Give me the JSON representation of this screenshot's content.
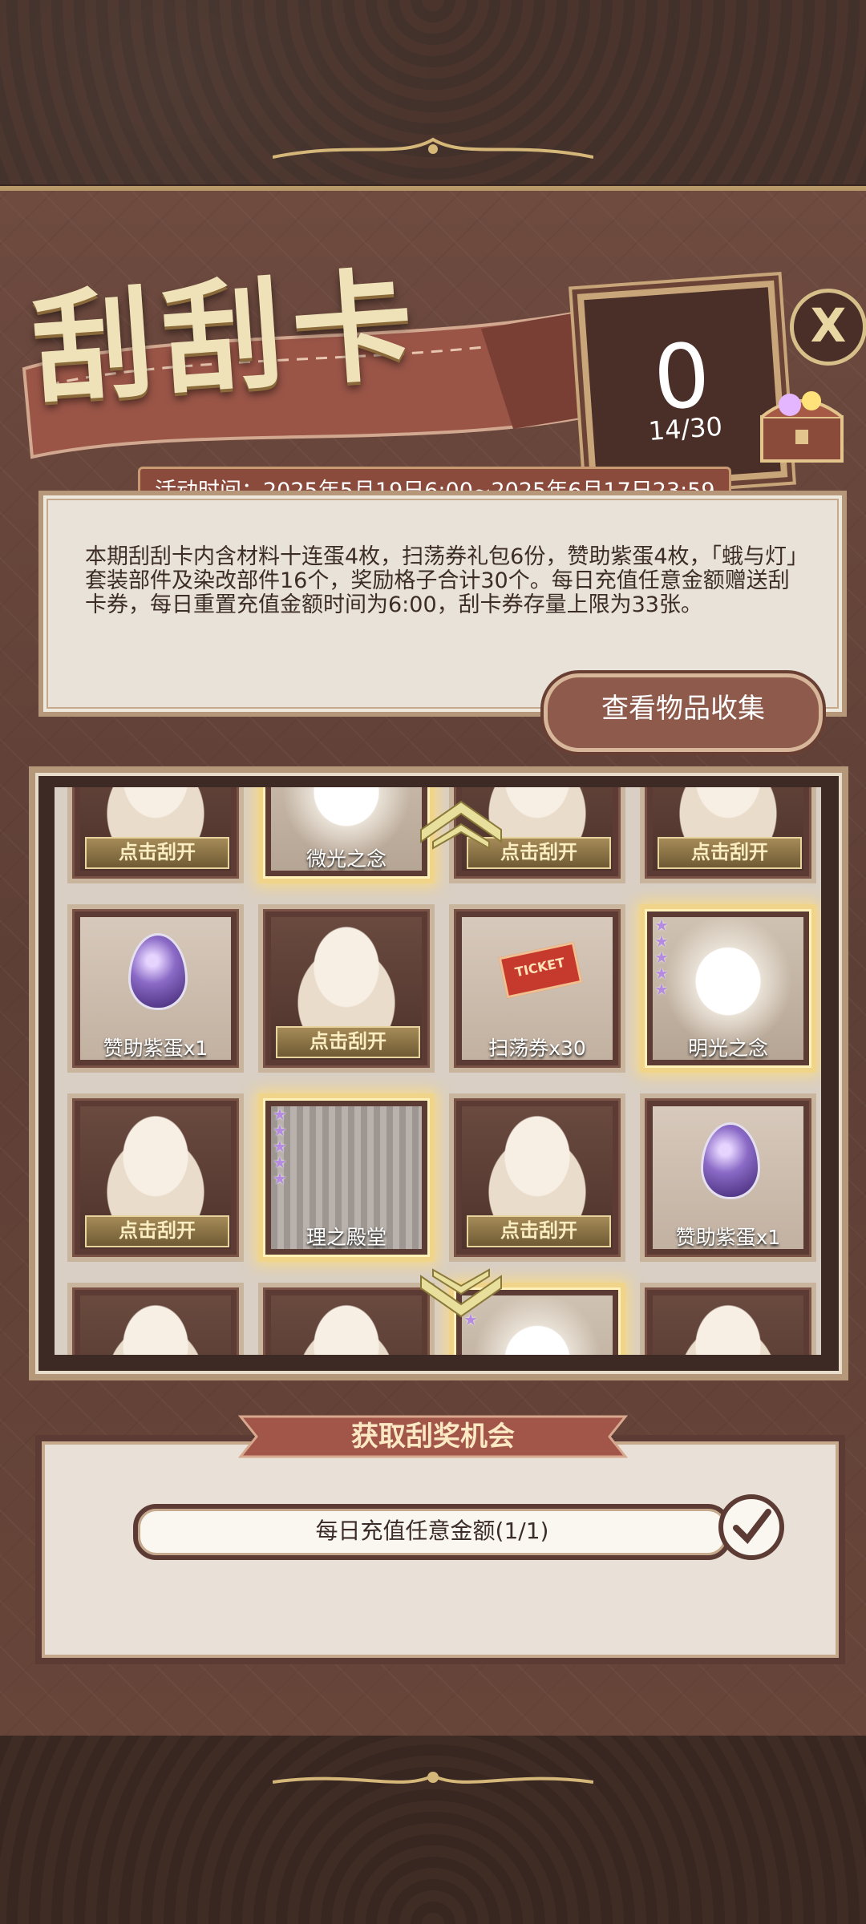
{
  "header": {
    "title": "刮刮卡",
    "counter": {
      "current": "0",
      "total": "14/30"
    },
    "close_label": "X"
  },
  "event": {
    "time": "活动时间：2025年5月19日6:00~2025年6月17日23:59",
    "description": "本期刮刮卡内含材料十连蛋4枚，扫荡券礼包6份，赞助紫蛋4枚，「蛾与灯」套装部件及染改部件16个，奖励格子合计30个。每日充值任意金额赠送刮卡券，每日重置充值金额时间为6:00，刮卡券存量上限为33张。",
    "collect_button": "查看物品收集"
  },
  "grid": {
    "scratch_label": "点击刮开",
    "rows": [
      [
        "点击刮开",
        "微光之念",
        "点击刮开",
        "点击刮开"
      ],
      [
        "赞助紫蛋x1",
        "点击刮开",
        "扫荡券x30",
        "明光之念"
      ],
      [
        "点击刮开",
        "理之殿堂",
        "点击刮开",
        "赞助紫蛋x1"
      ]
    ],
    "ticket_text": "TICKET"
  },
  "chances": {
    "title": "获取刮奖机会",
    "tasks": [
      {
        "label": "每日充值任意金额(1/1)",
        "done": true
      }
    ]
  },
  "colors": {
    "panel": "#6e4a3f",
    "accent": "#c9a67a",
    "gold": "#f0d489",
    "star": "#b48be0"
  }
}
